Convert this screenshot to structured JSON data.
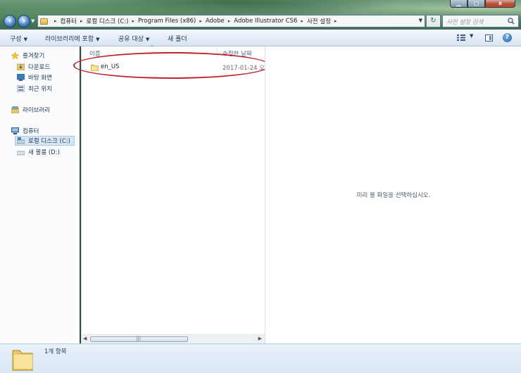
{
  "window": {
    "caption_buttons": {
      "minimize": "▁",
      "maximize": "▢",
      "close": "x"
    }
  },
  "address": {
    "segments": [
      "컴퓨터",
      "로컬 디스크 (C:)",
      "Program Files (x86)",
      "Adobe",
      "Adobe Illustrator CS6",
      "사전 설정"
    ],
    "separator": "▸",
    "dropdown_icon": "chevron-down-icon",
    "refresh_icon": "refresh-icon"
  },
  "search": {
    "placeholder": "사전 설정 검색",
    "icon": "search-icon"
  },
  "toolbar": {
    "organize": "구성",
    "include_in_library": "라이브러리에 포함",
    "share_with": "공유 대상",
    "new_folder": "새 폴더"
  },
  "nav": {
    "favorites": "즐겨찾기",
    "downloads": "다운로드",
    "desktop": "바탕 화면",
    "recent_places": "최근 위치",
    "libraries": "라이브러리",
    "computer": "컴퓨터",
    "local_disk_c": "로컬 디스크 (C:)",
    "new_volume_d": "새 볼륨 (D:)"
  },
  "columns": {
    "name": "이름",
    "date_modified": "수정한 날짜"
  },
  "files": [
    {
      "name": "en_US",
      "date": "2017-01-24 오",
      "type": "folder"
    }
  ],
  "preview": {
    "message": "미리 볼 파일을 선택하십시오."
  },
  "details": {
    "item_count": "1개 항목"
  },
  "colors": {
    "highlight_ellipse": "#c0242b",
    "command_bar": "#e7eef7",
    "details_pane": "#d9e6f5",
    "text": "#1e395b"
  }
}
